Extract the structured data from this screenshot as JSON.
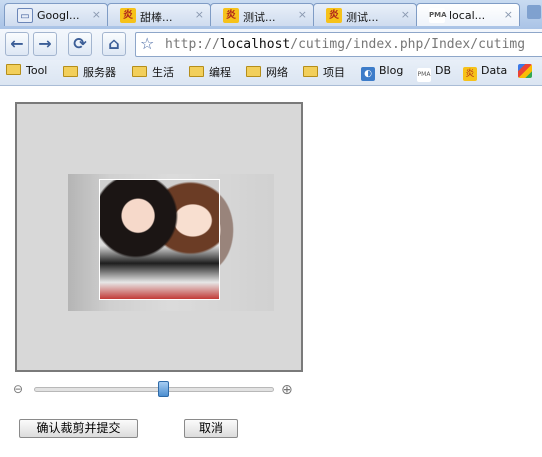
{
  "tabs": [
    {
      "title": "Googl...",
      "icon": "generic-page-icon",
      "close": "×"
    },
    {
      "title": "甜棒...",
      "icon": "yellow-site-icon",
      "close": "×"
    },
    {
      "title": "测试...",
      "icon": "yellow-site-icon",
      "close": "×"
    },
    {
      "title": "测试...",
      "icon": "yellow-site-icon",
      "close": "×"
    },
    {
      "title": "local...",
      "icon": "phpmyadmin-icon",
      "close": "×",
      "active": true
    }
  ],
  "toolbar": {
    "back": "←",
    "forward": "→",
    "reload": "⟳",
    "home": "⌂",
    "star": "☆"
  },
  "address": {
    "scheme": "http://",
    "host": "localhost",
    "path": "/cutimg/index.php/Index/cutimg"
  },
  "bookmarks": [
    {
      "label": "Tool",
      "type": "folder"
    },
    {
      "label": "服务器",
      "type": "folder"
    },
    {
      "label": "生活",
      "type": "folder"
    },
    {
      "label": "编程",
      "type": "folder"
    },
    {
      "label": "网络",
      "type": "folder"
    },
    {
      "label": "项目",
      "type": "folder"
    },
    {
      "label": "Blog",
      "type": "link",
      "icon": "blog-icon"
    },
    {
      "label": "DB",
      "type": "link",
      "icon": "phpmyadmin-icon"
    },
    {
      "label": "Data",
      "type": "link",
      "icon": "yellow-site-icon"
    }
  ],
  "zoom": {
    "out_icon": "⊖",
    "in_icon": "⊕",
    "value": 0.54
  },
  "buttons": {
    "confirm": "确认裁剪并提交",
    "cancel": "取消"
  },
  "colors": {
    "stage_bg": "#d8d8d8",
    "stage_border": "#7a7a7a",
    "slider_thumb": "#4d8fd0"
  }
}
